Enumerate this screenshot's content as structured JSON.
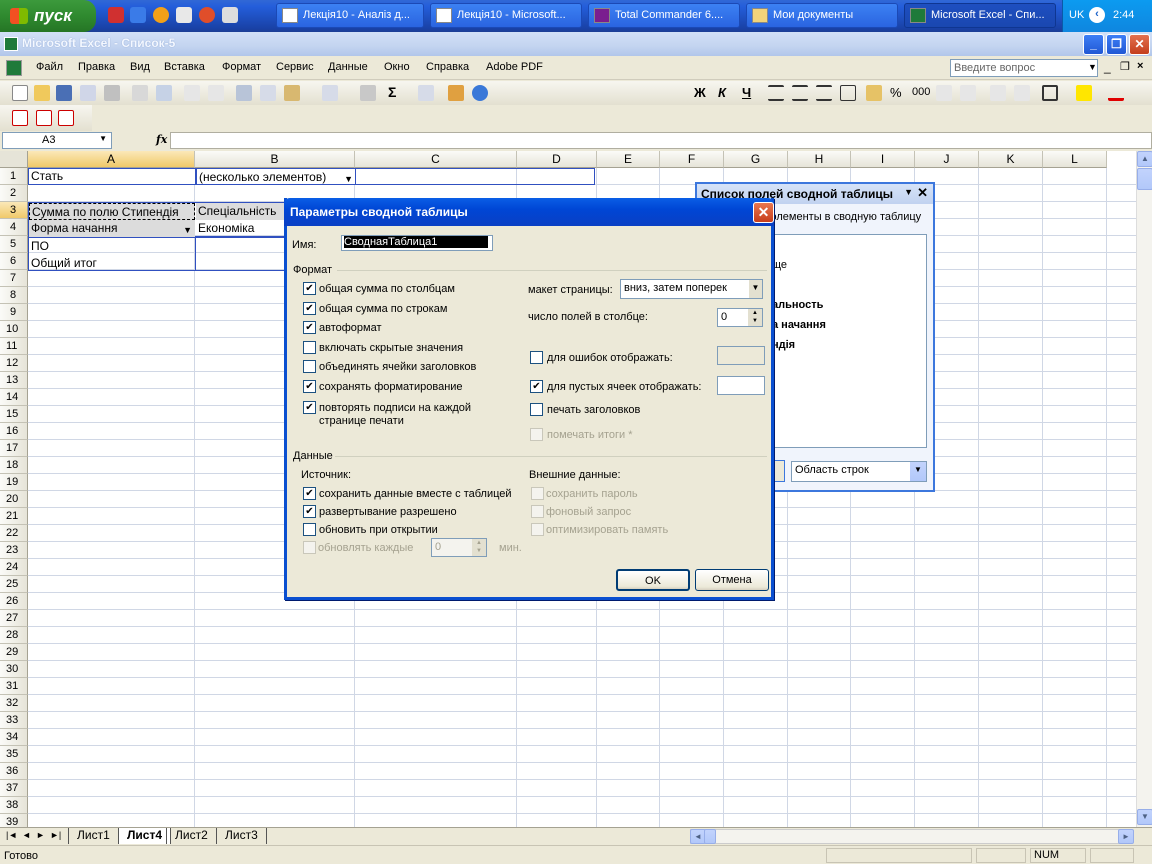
{
  "taskbar": {
    "start_label": "пуск",
    "buttons": [
      {
        "label": "Лекція10 - Аналіз д..."
      },
      {
        "label": "Лекція10 - Microsoft..."
      },
      {
        "label": "Total Commander 6...."
      },
      {
        "label": "Мои документы"
      },
      {
        "label": "Microsoft Excel - Спи..."
      }
    ],
    "lang": "UK",
    "clock": "2:44"
  },
  "window": {
    "title": "Microsoft Excel - Список-5"
  },
  "menu": {
    "items": [
      "Файл",
      "Правка",
      "Вид",
      "Вставка",
      "Формат",
      "Сервис",
      "Данные",
      "Окно",
      "Справка",
      "Adobe PDF"
    ],
    "ask_placeholder": "Введите вопрос"
  },
  "toolbar": {
    "font": "Arial Cyr",
    "size": "10",
    "bold": "Ж",
    "italic": "К",
    "underline": "Ч",
    "sigma": "Σ",
    "percent": "%",
    "thousands": "000"
  },
  "formula_bar": {
    "name_box": "A3",
    "fx": "fx",
    "content": ""
  },
  "grid": {
    "columns": [
      "A",
      "B",
      "C",
      "D",
      "E",
      "F",
      "G",
      "H",
      "I",
      "J",
      "K",
      "L"
    ],
    "rows": [
      "1",
      "2",
      "3",
      "4",
      "5",
      "6",
      "7",
      "8",
      "9",
      "10",
      "11",
      "12",
      "13",
      "14",
      "15",
      "16",
      "17",
      "18",
      "19",
      "20",
      "21",
      "22",
      "23",
      "24",
      "25",
      "26",
      "27",
      "28",
      "29",
      "30",
      "31",
      "32",
      "33",
      "34",
      "35",
      "36",
      "37",
      "38",
      "39",
      "40"
    ],
    "cells": {
      "A1": "Стать",
      "B1": "(несколько элементов)",
      "A3": "Сумма по полю Стипендія",
      "B3": "Спеціальність",
      "A4": "Форма начання",
      "B4": "Економіка",
      "A5": "ПО",
      "A6": "Общий итог"
    }
  },
  "sheets": {
    "tabs": [
      "Лист1",
      "Лист4",
      "Лист2",
      "Лист3"
    ],
    "active": "Лист4"
  },
  "status": {
    "left": "Готово",
    "num": "NUM"
  },
  "pivot_field_list": {
    "title": "Список полей сводной таблицы",
    "hint": "элементы в сводную таблицу",
    "fields": [
      "ще",
      "альность",
      "а начання",
      "ндія"
    ],
    "area": "Область строк"
  },
  "dialog": {
    "title": "Параметры сводной таблицы",
    "name_label": "Имя:",
    "name_value": "СводнаяТаблица1",
    "format_group": "Формат",
    "data_group": "Данные",
    "format_options": [
      {
        "label": "общая сумма по столбцам",
        "checked": true
      },
      {
        "label": "общая сумма по строкам",
        "checked": true
      },
      {
        "label": "автоформат",
        "checked": true
      },
      {
        "label": "включать скрытые значения",
        "checked": false
      },
      {
        "label": "объединять ячейки заголовков",
        "checked": false
      },
      {
        "label": "сохранять форматирование",
        "checked": true
      },
      {
        "label": "повторять подписи на каждой",
        "label2": "странице печати",
        "checked": true
      }
    ],
    "layout_label": "макет страницы:",
    "layout_value": "вниз, затем поперек",
    "fields_per_col_label": "число полей в столбце:",
    "fields_per_col_value": "0",
    "errors_label": "для ошибок отображать:",
    "errors_checked": false,
    "empty_label": "для пустых ячеек отображать:",
    "empty_checked": true,
    "print_titles_label": "печать заголовков",
    "print_titles_checked": false,
    "mark_totals_label": "помечать итоги *",
    "source_label": "Источник:",
    "source_options": [
      {
        "label": "сохранить данные вместе с таблицей",
        "checked": true
      },
      {
        "label": "развертывание разрешено",
        "checked": true
      },
      {
        "label": "обновить при открытии",
        "checked": false
      }
    ],
    "refresh_every_label": "обновлять каждые",
    "refresh_every_value": "0",
    "refresh_unit": "мин.",
    "external_label": "Внешние данные:",
    "external_options": [
      "сохранить пароль",
      "фоновый запрос",
      "оптимизировать память"
    ],
    "ok": "OK",
    "cancel": "Отмена"
  }
}
